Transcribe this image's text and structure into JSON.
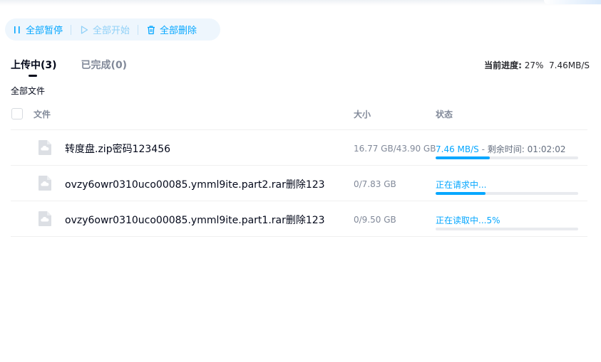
{
  "toolbar": {
    "pause_all": "全部暂停",
    "start_all": "全部开始",
    "delete_all": "全部删除"
  },
  "tabs": [
    {
      "label": "上传中(3)",
      "active": true
    },
    {
      "label": "已完成(0)",
      "active": false
    }
  ],
  "progress_summary": {
    "label": "当前进度:",
    "percent": "27%",
    "speed": "7.46MB/S"
  },
  "all_files_label": "全部文件",
  "table": {
    "headers": {
      "name": "文件",
      "size": "大小",
      "status": "状态"
    },
    "rows": [
      {
        "name": "转度盘.zip密码123456",
        "size": "16.77 GB/43.90 GB",
        "speed": "7.46 MB/S",
        "separator": " - ",
        "remaining": "剩余时间: 01:02:02",
        "progress": 0.38
      },
      {
        "name": "ovzy6owr0310uco00085.ymml9ite.part2.rar删除123",
        "size": "0/7.83 GB",
        "status": "正在请求中...",
        "progress": 0.35
      },
      {
        "name": "ovzy6owr0310uco00085.ymml9ite.part1.rar删除123",
        "size": "0/9.50 GB",
        "status": "正在读取中...5%",
        "progress": 0.0
      }
    ]
  },
  "colors": {
    "accent": "#06a7ff",
    "track": "#e9ebef",
    "text_primary": "#03081a",
    "text_secondary": "#818999"
  },
  "icons": {
    "pause": "pause-icon",
    "start": "play-icon",
    "delete": "trash-icon",
    "file": "cloud-file-icon"
  }
}
